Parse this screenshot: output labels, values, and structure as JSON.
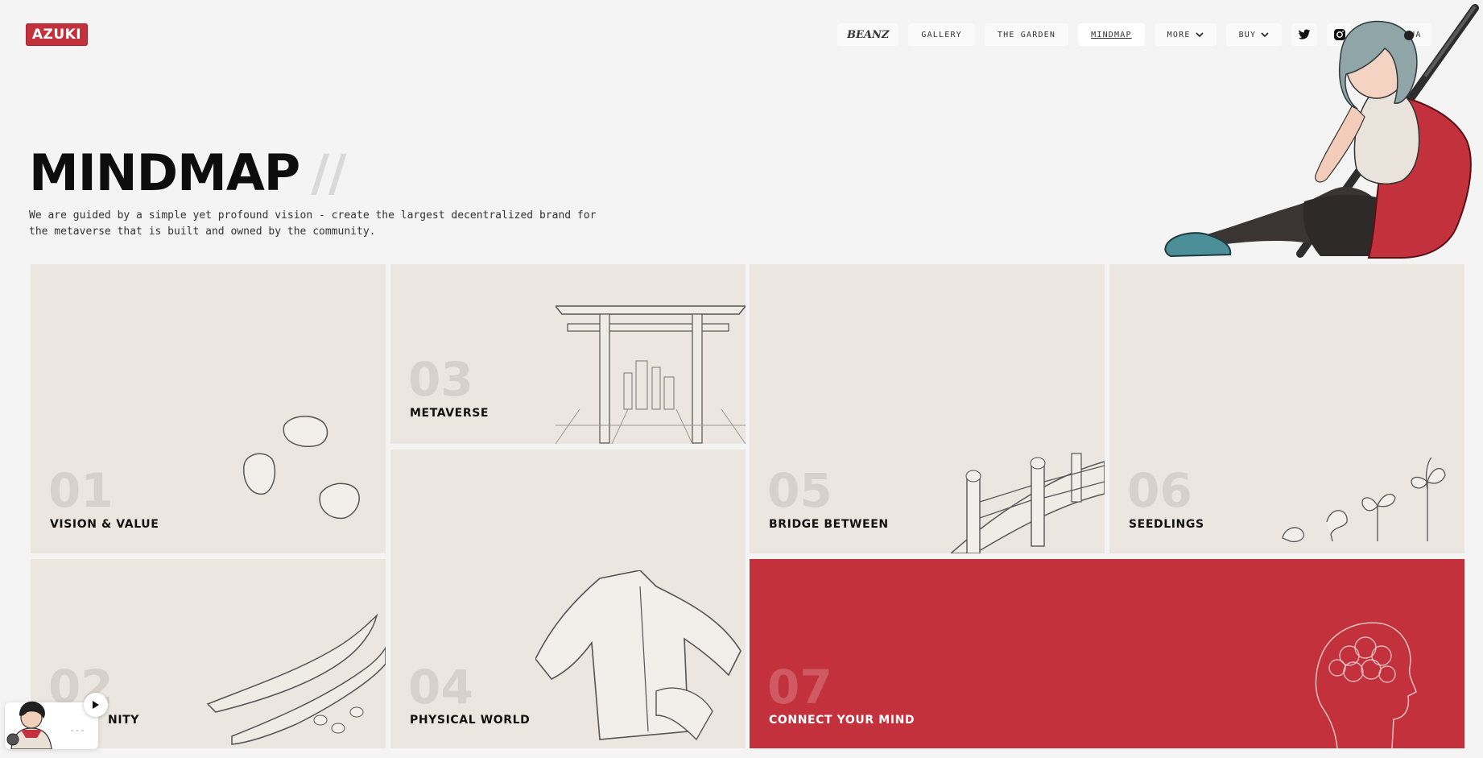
{
  "brand": {
    "logo_text": "AZUKI"
  },
  "nav": {
    "items": [
      {
        "label": "BEANZ",
        "icon": "beanz-logo-icon"
      },
      {
        "label": "GALLERY"
      },
      {
        "label": "THE GARDEN"
      },
      {
        "label": "MINDMAP",
        "active": true
      },
      {
        "label": "MORE",
        "icon": "chevron-down-icon"
      },
      {
        "label": "BUY",
        "icon": "chevron-down-icon"
      }
    ],
    "social": [
      "twitter-icon",
      "instagram-icon"
    ],
    "language_label": "LANGUA"
  },
  "hero": {
    "title": "MINDMAP",
    "slash": "//",
    "subtitle": "We are guided by a simple yet profound vision - create the largest decentralized brand for the metaverse that is built and owned by the community."
  },
  "tiles": [
    {
      "num": "01",
      "label": "VISION & VALUE"
    },
    {
      "num": "02",
      "label": "NITY"
    },
    {
      "num": "03",
      "label": "METAVERSE"
    },
    {
      "num": "04",
      "label": "PHYSICAL WORLD"
    },
    {
      "num": "05",
      "label": "BRIDGE BETWEEN"
    },
    {
      "num": "06",
      "label": "SEEDLINGS"
    },
    {
      "num": "07",
      "label": "CONNECT YOUR MIND"
    }
  ],
  "player": {
    "status": "---"
  },
  "colors": {
    "accent": "#c3313d",
    "tile_bg": "#ebe6e0",
    "page_bg": "#f4f4f4"
  }
}
